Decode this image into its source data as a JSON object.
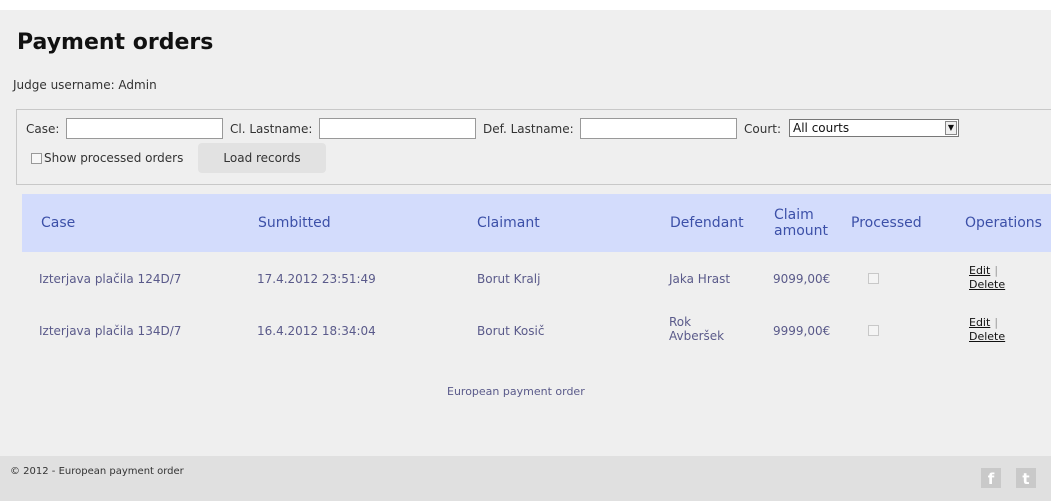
{
  "page": {
    "title": "Payment orders",
    "judge_line": "Judge username: Admin"
  },
  "filters": {
    "case_label": "Case:",
    "case_value": "",
    "cl_lastname_label": "Cl. Lastname:",
    "cl_lastname_value": "",
    "def_lastname_label": "Def. Lastname:",
    "def_lastname_value": "",
    "court_label": "Court:",
    "court_selected": "All courts",
    "show_processed_label": "Show processed orders",
    "show_processed_checked": false,
    "load_button": "Load records"
  },
  "table": {
    "headers": {
      "case": "Case",
      "submitted": "Sumbitted",
      "claimant": "Claimant",
      "defendant": "Defendant",
      "claim_amount_line1": "Claim",
      "claim_amount_line2": "amount",
      "processed": "Processed",
      "operations": "Operations"
    },
    "rows": [
      {
        "case": "Izterjava plačila 124D/7",
        "submitted": "17.4.2012 23:51:49",
        "claimant": "Borut Kralj",
        "defendant_line1": "Jaka Hrast",
        "defendant_line2": "",
        "amount": "9099,00€",
        "processed": false,
        "edit": "Edit",
        "sep": "|",
        "delete": "Delete"
      },
      {
        "case": "Izterjava plačila 134D/7",
        "submitted": "16.4.2012 18:34:04",
        "claimant": "Borut Kosič",
        "defendant_line1": "Rok",
        "defendant_line2": "Avberšek",
        "amount": "9999,00€",
        "processed": false,
        "edit": "Edit",
        "sep": "|",
        "delete": "Delete"
      }
    ]
  },
  "bottom_link": "European payment order",
  "footer": {
    "copyright": "© 2012 - European payment order",
    "facebook_icon": "f",
    "twitter_icon": "t"
  },
  "colors": {
    "header_bg": "#d3dcfc",
    "header_text": "#3c50a8",
    "cell_text": "#5a5a8a",
    "page_bg": "#efefef",
    "footer_bg": "#e0e0e0"
  }
}
